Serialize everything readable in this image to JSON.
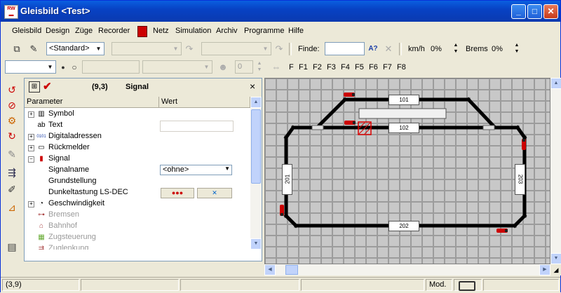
{
  "window": {
    "title": "Gleisbild <Test>",
    "logo_text": "RW"
  },
  "menu": [
    "Gleisbild",
    "Design",
    "Züge",
    "Recorder",
    "Netz",
    "Simulation",
    "Archiv",
    "Programme",
    "Hilfe"
  ],
  "toolbar1": {
    "style_combo": "<Standard>",
    "find_label": "Finde:",
    "find_value": "",
    "kmh_label": "km/h",
    "kmh_value": "0%",
    "brems_label": "Brems",
    "brems_value": "0%"
  },
  "toolbar2": {
    "speed_value": "0",
    "functions": [
      "F",
      "F1",
      "F2",
      "F3",
      "F4",
      "F5",
      "F6",
      "F7",
      "F8"
    ]
  },
  "panel": {
    "coords": "(9,3)",
    "title": "Signal",
    "close": "×",
    "col_param": "Parameter",
    "col_value": "Wert",
    "rows": [
      {
        "name": "Symbol",
        "expander": "+"
      },
      {
        "name": "Text",
        "icon": "ab"
      },
      {
        "name": "Digitaladressen",
        "expander": "+"
      },
      {
        "name": "Rückmelder",
        "expander": "+"
      },
      {
        "name": "Signal",
        "expander": "−"
      },
      {
        "name": "Signalname",
        "value": "<ohne>"
      },
      {
        "name": "Grundstellung"
      },
      {
        "name": "Dunkeltastung LS-DEC"
      },
      {
        "name": "Geschwindigkeit",
        "expander": "+"
      },
      {
        "name": "Bremsen"
      },
      {
        "name": "Bahnhof"
      },
      {
        "name": "Zugsteuerung"
      },
      {
        "name": "Zuglenkung"
      }
    ]
  },
  "track": {
    "blocks": [
      "101",
      "102",
      "201",
      "202",
      "203"
    ]
  },
  "status": {
    "coords": "(3,9)",
    "mode": "Mod."
  },
  "colors": {
    "title_blue": "#0842c4",
    "grid_bg": "#9c9c9c",
    "track": "#000000",
    "signal_red": "#d00000"
  }
}
